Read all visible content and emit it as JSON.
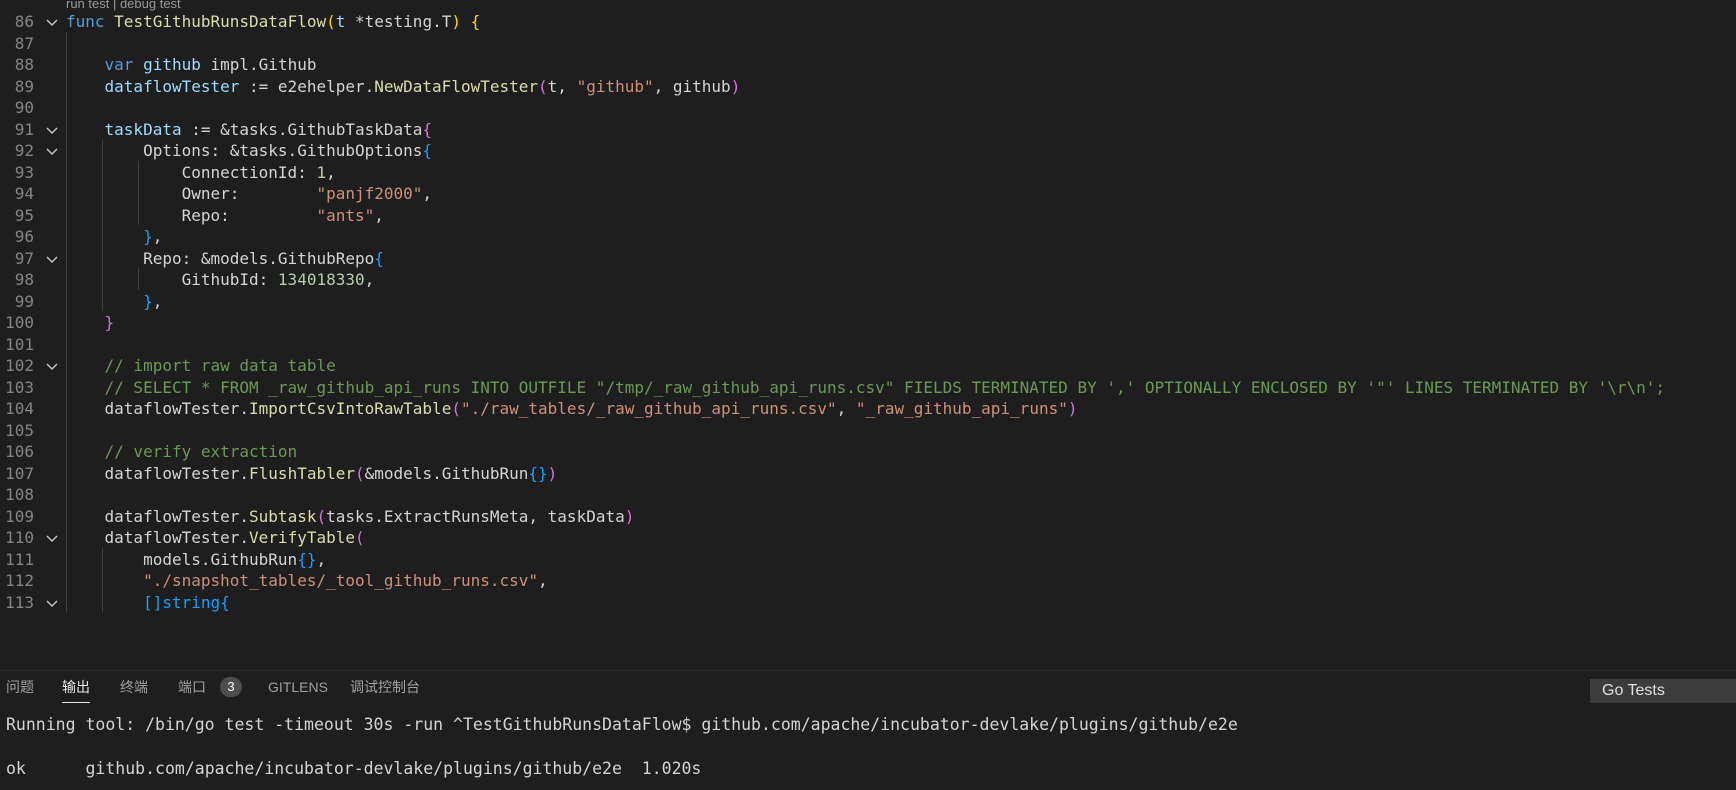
{
  "editor": {
    "codelens": "run test | debug test",
    "lines": [
      {
        "n": "86",
        "fold": true,
        "indent": 0,
        "tokens": [
          {
            "t": "func",
            "c": "kw"
          },
          {
            "t": " "
          },
          {
            "t": "TestGithubRunsDataFlow",
            "c": "fn"
          },
          {
            "t": "(",
            "c": "b1"
          },
          {
            "t": "t",
            "c": "var"
          },
          {
            "t": " *testing.T"
          },
          {
            "t": ")",
            "c": "b1"
          },
          {
            "t": " "
          },
          {
            "t": "{",
            "c": "b1"
          }
        ]
      },
      {
        "n": "87",
        "fold": false,
        "indent": 1,
        "tokens": []
      },
      {
        "n": "88",
        "fold": false,
        "indent": 1,
        "tokens": [
          {
            "t": "    "
          },
          {
            "t": "var",
            "c": "kw"
          },
          {
            "t": " "
          },
          {
            "t": "github",
            "c": "var"
          },
          {
            "t": " impl.Github"
          }
        ]
      },
      {
        "n": "89",
        "fold": false,
        "indent": 1,
        "tokens": [
          {
            "t": "    "
          },
          {
            "t": "dataflowTester",
            "c": "var"
          },
          {
            "t": " := e2ehelper."
          },
          {
            "t": "NewDataFlowTester",
            "c": "fn"
          },
          {
            "t": "(",
            "c": "b2"
          },
          {
            "t": "t, "
          },
          {
            "t": "\"github\"",
            "c": "str"
          },
          {
            "t": ", github"
          },
          {
            "t": ")",
            "c": "b2"
          }
        ]
      },
      {
        "n": "90",
        "fold": false,
        "indent": 1,
        "tokens": []
      },
      {
        "n": "91",
        "fold": true,
        "indent": 1,
        "tokens": [
          {
            "t": "    "
          },
          {
            "t": "taskData",
            "c": "var"
          },
          {
            "t": " := &tasks.GithubTaskData"
          },
          {
            "t": "{",
            "c": "b2"
          }
        ]
      },
      {
        "n": "92",
        "fold": true,
        "indent": 2,
        "tokens": [
          {
            "t": "        Options: &tasks.GithubOptions"
          },
          {
            "t": "{",
            "c": "b3"
          }
        ]
      },
      {
        "n": "93",
        "fold": false,
        "indent": 3,
        "tokens": [
          {
            "t": "            ConnectionId: "
          },
          {
            "t": "1",
            "c": "num"
          },
          {
            "t": ","
          }
        ]
      },
      {
        "n": "94",
        "fold": false,
        "indent": 3,
        "tokens": [
          {
            "t": "            Owner:        "
          },
          {
            "t": "\"panjf2000\"",
            "c": "str"
          },
          {
            "t": ","
          }
        ]
      },
      {
        "n": "95",
        "fold": false,
        "indent": 3,
        "tokens": [
          {
            "t": "            Repo:         "
          },
          {
            "t": "\"ants\"",
            "c": "str"
          },
          {
            "t": ","
          }
        ]
      },
      {
        "n": "96",
        "fold": false,
        "indent": 2,
        "tokens": [
          {
            "t": "        "
          },
          {
            "t": "}",
            "c": "b3"
          },
          {
            "t": ","
          }
        ]
      },
      {
        "n": "97",
        "fold": true,
        "indent": 2,
        "tokens": [
          {
            "t": "        Repo: &models.GithubRepo"
          },
          {
            "t": "{",
            "c": "b3"
          }
        ]
      },
      {
        "n": "98",
        "fold": false,
        "indent": 3,
        "tokens": [
          {
            "t": "            GithubId: "
          },
          {
            "t": "134018330",
            "c": "num"
          },
          {
            "t": ","
          }
        ]
      },
      {
        "n": "99",
        "fold": false,
        "indent": 2,
        "tokens": [
          {
            "t": "        "
          },
          {
            "t": "}",
            "c": "b3"
          },
          {
            "t": ","
          }
        ]
      },
      {
        "n": "100",
        "fold": false,
        "indent": 1,
        "tokens": [
          {
            "t": "    "
          },
          {
            "t": "}",
            "c": "b2"
          }
        ]
      },
      {
        "n": "101",
        "fold": false,
        "indent": 1,
        "tokens": []
      },
      {
        "n": "102",
        "fold": true,
        "indent": 1,
        "tokens": [
          {
            "t": "    "
          },
          {
            "t": "// import raw data table",
            "c": "cmt"
          }
        ]
      },
      {
        "n": "103",
        "fold": false,
        "indent": 1,
        "tokens": [
          {
            "t": "    "
          },
          {
            "t": "// SELECT * FROM _raw_github_api_runs INTO OUTFILE \"/tmp/_raw_github_api_runs.csv\" FIELDS TERMINATED BY ',' OPTIONALLY ENCLOSED BY '\"' LINES TERMINATED BY '\\r\\n';",
            "c": "cmt"
          }
        ]
      },
      {
        "n": "104",
        "fold": false,
        "indent": 1,
        "tokens": [
          {
            "t": "    dataflowTester."
          },
          {
            "t": "ImportCsvIntoRawTable",
            "c": "fn"
          },
          {
            "t": "(",
            "c": "b2"
          },
          {
            "t": "\"./raw_tables/_raw_github_api_runs.csv\"",
            "c": "str"
          },
          {
            "t": ", "
          },
          {
            "t": "\"_raw_github_api_runs\"",
            "c": "str"
          },
          {
            "t": ")",
            "c": "b2"
          }
        ]
      },
      {
        "n": "105",
        "fold": false,
        "indent": 1,
        "tokens": []
      },
      {
        "n": "106",
        "fold": false,
        "indent": 1,
        "tokens": [
          {
            "t": "    "
          },
          {
            "t": "// verify extraction",
            "c": "cmt"
          }
        ]
      },
      {
        "n": "107",
        "fold": false,
        "indent": 1,
        "tokens": [
          {
            "t": "    dataflowTester."
          },
          {
            "t": "FlushTabler",
            "c": "fn"
          },
          {
            "t": "(",
            "c": "b2"
          },
          {
            "t": "&models.GithubRun"
          },
          {
            "t": "{}",
            "c": "b3"
          },
          {
            "t": ")",
            "c": "b2"
          }
        ]
      },
      {
        "n": "108",
        "fold": false,
        "indent": 1,
        "tokens": []
      },
      {
        "n": "109",
        "fold": false,
        "indent": 1,
        "tokens": [
          {
            "t": "    dataflowTester."
          },
          {
            "t": "Subtask",
            "c": "fn"
          },
          {
            "t": "(",
            "c": "b2"
          },
          {
            "t": "tasks.ExtractRunsMeta, taskData"
          },
          {
            "t": ")",
            "c": "b2"
          }
        ]
      },
      {
        "n": "110",
        "fold": true,
        "indent": 1,
        "tokens": [
          {
            "t": "    dataflowTester."
          },
          {
            "t": "VerifyTable",
            "c": "fn"
          },
          {
            "t": "(",
            "c": "b2"
          }
        ]
      },
      {
        "n": "111",
        "fold": false,
        "indent": 2,
        "tokens": [
          {
            "t": "        models.GithubRun"
          },
          {
            "t": "{}",
            "c": "b3"
          },
          {
            "t": ","
          }
        ]
      },
      {
        "n": "112",
        "fold": false,
        "indent": 2,
        "tokens": [
          {
            "t": "        "
          },
          {
            "t": "\"./snapshot_tables/_tool_github_runs.csv\"",
            "c": "str"
          },
          {
            "t": ","
          }
        ]
      },
      {
        "n": "113",
        "fold": true,
        "indent": 2,
        "tokens": [
          {
            "t": "        "
          },
          {
            "t": "[]string",
            "c": "b3"
          },
          {
            "t": "{",
            "c": "b3"
          }
        ]
      }
    ]
  },
  "panel": {
    "tabs": [
      {
        "label": "问题",
        "active": false
      },
      {
        "label": "输出",
        "active": true
      },
      {
        "label": "终端",
        "active": false
      },
      {
        "label": "端口",
        "active": false,
        "badge": "3"
      },
      {
        "label": "GITLENS",
        "active": false
      },
      {
        "label": "调试控制台",
        "active": false
      }
    ],
    "channel": "Go Tests",
    "output": [
      "Running tool: /bin/go test -timeout 30s -run ^TestGithubRunsDataFlow$ github.com/apache/incubator-devlake/plugins/github/e2e",
      "",
      "ok  \tgithub.com/apache/incubator-devlake/plugins/github/e2e\t1.020s"
    ]
  }
}
